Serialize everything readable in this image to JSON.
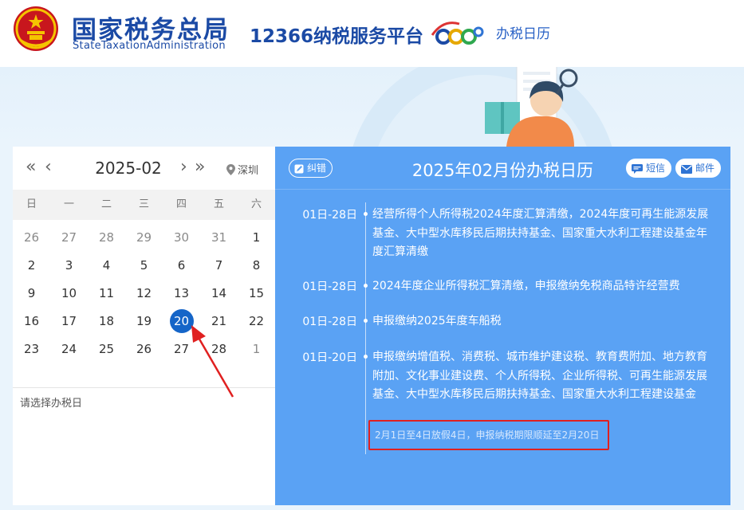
{
  "header": {
    "org_cn": "国家税务总局",
    "org_en": "StateTaxationAdministration",
    "platform": "12366纳税服务平台",
    "nav_link": "办税日历"
  },
  "calendar": {
    "month": "2025-02",
    "city": "深圳",
    "prev_year": "«",
    "prev_month": "‹",
    "next_month": "›",
    "next_year": "»",
    "weekdays": [
      "日",
      "一",
      "二",
      "三",
      "四",
      "五",
      "六"
    ],
    "weeks": [
      [
        "26",
        "27",
        "28",
        "29",
        "30",
        "31",
        "1"
      ],
      [
        "2",
        "3",
        "4",
        "5",
        "6",
        "7",
        "8"
      ],
      [
        "9",
        "10",
        "11",
        "12",
        "13",
        "14",
        "15"
      ],
      [
        "16",
        "17",
        "18",
        "19",
        "20",
        "21",
        "22"
      ],
      [
        "23",
        "24",
        "25",
        "26",
        "27",
        "28",
        "1"
      ]
    ],
    "selected": "20",
    "hint": "请选择办税日"
  },
  "tax_calendar": {
    "title": "2025年02月份办税日历",
    "correction_label": "纠错",
    "sms_label": "短信",
    "email_label": "邮件",
    "entries": [
      {
        "date": "01日-28日",
        "text": "经营所得个人所得税2024年度汇算清缴，2024年度可再生能源发展基金、大中型水库移民后期扶持基金、国家重大水利工程建设基金年度汇算清缴"
      },
      {
        "date": "01日-28日",
        "text": "2024年度企业所得税汇算清缴，申报缴纳免税商品特许经营费"
      },
      {
        "date": "01日-28日",
        "text": "申报缴纳2025年度车船税"
      },
      {
        "date": "01日-20日",
        "text": "申报缴纳增值税、消费税、城市维护建设税、教育费附加、地方教育附加、文化事业建设费、个人所得税、企业所得税、可再生能源发展基金、大中型水库移民后期扶持基金、国家重大水利工程建设基金"
      }
    ],
    "note": "2月1日至4日放假4日，申报纳税期限顺延至2月20日"
  },
  "colors": {
    "brand_blue": "#1b4aa5",
    "panel_blue": "#5aa2f4",
    "selected_day": "#1565c8",
    "highlight_red": "#e02020"
  },
  "icons": [
    "national-emblem-icon",
    "location-pin-icon",
    "correction-icon",
    "sms-icon",
    "email-icon"
  ]
}
